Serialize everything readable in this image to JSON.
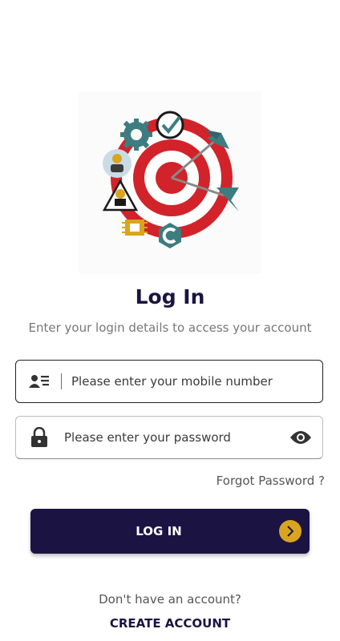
{
  "header": {
    "title": "Log In",
    "subtitle": "Enter your login details to access your account"
  },
  "form": {
    "mobile": {
      "placeholder": "Please enter your mobile number",
      "icon": "contact-card-icon"
    },
    "password": {
      "placeholder": "Please enter your password",
      "icon": "lock-icon",
      "toggle_icon": "eye-icon"
    },
    "forgot_label": "Forgot Password ?",
    "login_label": "LOG IN",
    "login_icon": "chevron-right-circle-icon"
  },
  "footer": {
    "prompt": "Don't have an account?",
    "create_label": "CREATE ACCOUNT"
  },
  "colors": {
    "brand_dark": "#1b1442",
    "accent_gold": "#d9a520",
    "target_red": "#d2232a",
    "teal": "#3d7d80"
  }
}
